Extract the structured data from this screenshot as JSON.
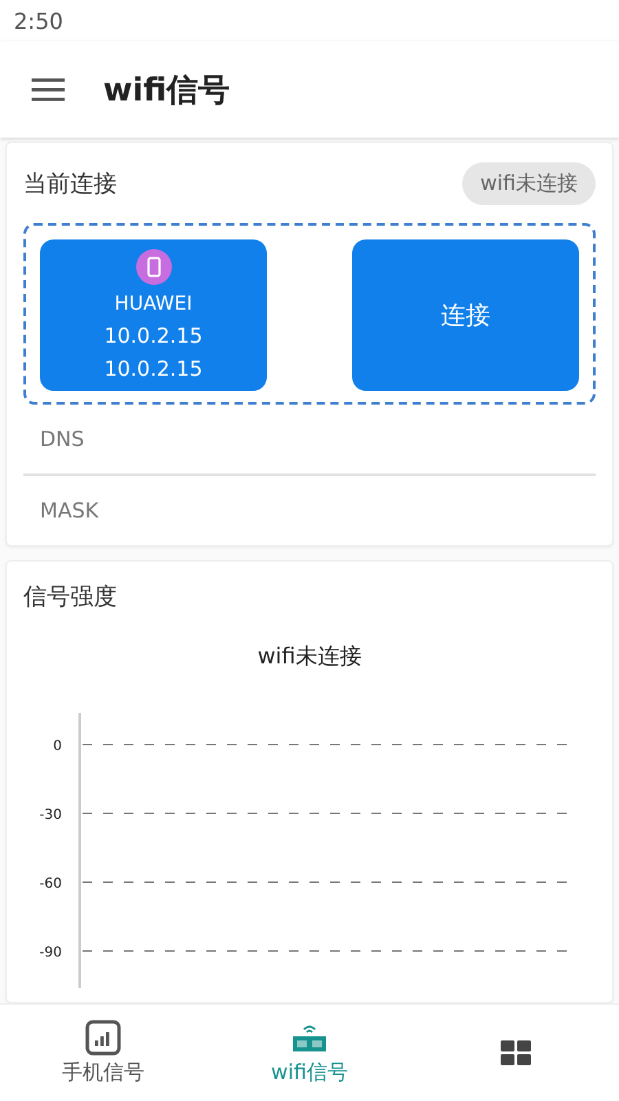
{
  "status_bar": {
    "time": "2:50"
  },
  "app_bar": {
    "title": "wifi信号"
  },
  "connection_card": {
    "title": "当前连接",
    "status_chip": "wifi未连接",
    "device": {
      "name": "HUAWEI",
      "lines": [
        "10.0.2.15",
        "10.0.2.15"
      ]
    },
    "connect_button": "连接",
    "fields": [
      "DNS",
      "MASK"
    ]
  },
  "signal_card": {
    "title": "信号强度",
    "empty_chart": {
      "title": "wifi未连接",
      "axis_labels": [
        "0",
        "-30",
        "-60",
        "-90"
      ]
    }
  },
  "bottom_nav": [
    {
      "label": "手机信号",
      "kind": "bars",
      "selected": false
    },
    {
      "label": "wifi信号",
      "kind": "wifi",
      "selected": true
    },
    {
      "kind": "grid",
      "selected": false
    }
  ]
}
